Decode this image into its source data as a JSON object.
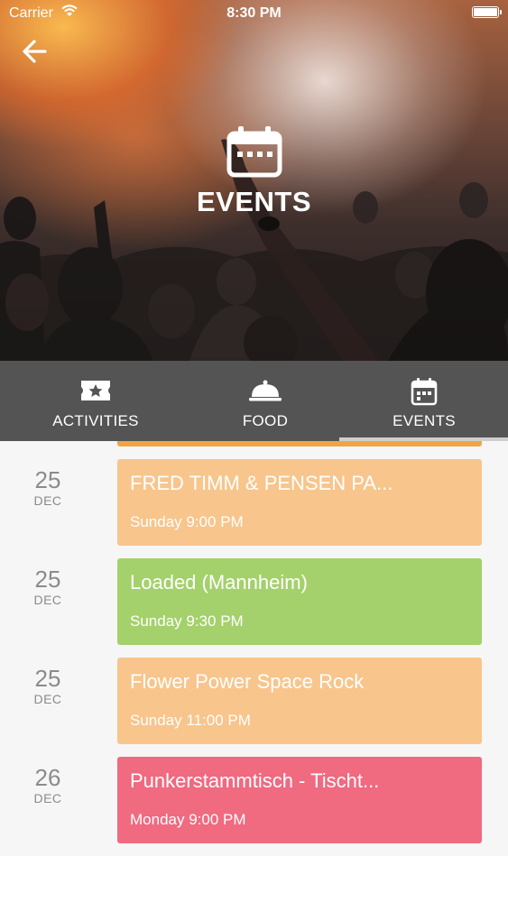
{
  "status_bar": {
    "carrier": "Carrier",
    "time": "8:30 PM"
  },
  "header": {
    "title": "EVENTS",
    "back_icon": "arrow-left-icon",
    "hero_icon": "calendar-icon"
  },
  "tabs": [
    {
      "label": "ACTIVITIES",
      "icon": "ticket-star-icon",
      "active": false
    },
    {
      "label": "FOOD",
      "icon": "food-cloche-icon",
      "active": false
    },
    {
      "label": "EVENTS",
      "icon": "calendar-icon",
      "active": true
    }
  ],
  "events": [
    {
      "day": "25",
      "month": "DEC",
      "title": "FRED TIMM & PENSEN PA...",
      "time": "Sunday 9:00 PM",
      "color": "#f8c58c"
    },
    {
      "day": "25",
      "month": "DEC",
      "title": "Loaded (Mannheim)",
      "time": "Sunday 9:30 PM",
      "color": "#a4d16b"
    },
    {
      "day": "25",
      "month": "DEC",
      "title": "Flower Power Space Rock",
      "time": "Sunday 11:00 PM",
      "color": "#f8c58c"
    },
    {
      "day": "26",
      "month": "DEC",
      "title": "Punkerstammtisch - Tischt...",
      "time": "Monday 9:00 PM",
      "color": "#f06a80"
    }
  ],
  "colors": {
    "tabbar": "#545454",
    "top_strip": "#f1a345"
  }
}
